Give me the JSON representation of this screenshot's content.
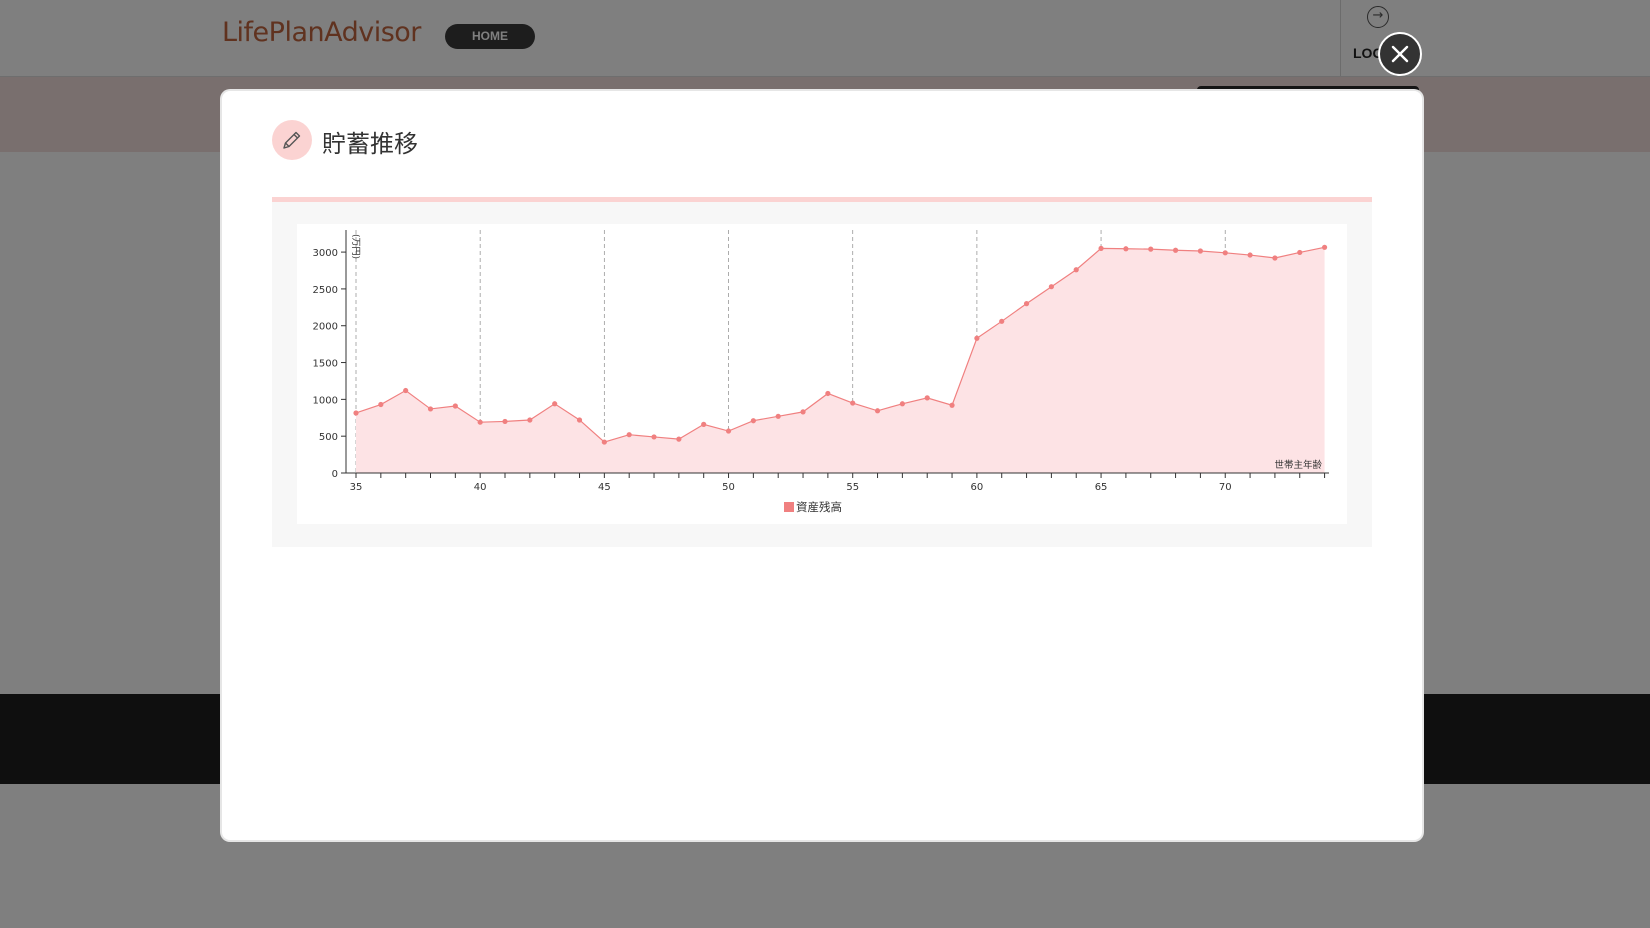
{
  "header": {
    "logo_text": "LifePlanAdvisor",
    "home_label": "HOME",
    "logout_label": "LOG"
  },
  "modal": {
    "title": "貯蓄推移",
    "close_icon": "close-icon",
    "title_icon": "pencil-icon"
  },
  "colors": {
    "series": "#f08080",
    "area": "#fde3e5",
    "accent_pink": "#fbd3d2",
    "close_bg": "#333333"
  },
  "chart_data": {
    "type": "area",
    "title": "",
    "xlabel": "世帯主年齢",
    "ylabel": "(万円)",
    "xlim": [
      35,
      74.5
    ],
    "ylim": [
      0,
      3300
    ],
    "xticks": [
      35,
      40,
      45,
      50,
      55,
      60,
      65,
      70
    ],
    "yticks": [
      0,
      500,
      1000,
      1500,
      2000,
      2500,
      3000
    ],
    "grid": "vertical-dashed",
    "legend_position": "bottom-center",
    "x": [
      35,
      36,
      37,
      38,
      39,
      40,
      41,
      42,
      43,
      44,
      45,
      46,
      47,
      48,
      49,
      50,
      51,
      52,
      53,
      54,
      55,
      56,
      57,
      58,
      59,
      60,
      61,
      62,
      63,
      64,
      65,
      66,
      67,
      68,
      69,
      70,
      71,
      72,
      73,
      74
    ],
    "series": [
      {
        "name": "資産残高",
        "values": [
          815,
          930,
          1120,
          870,
          910,
          690,
          700,
          720,
          940,
          720,
          420,
          520,
          490,
          460,
          660,
          570,
          710,
          770,
          830,
          1080,
          950,
          845,
          940,
          1020,
          920,
          1830,
          2060,
          2300,
          2530,
          2760,
          3050,
          3045,
          3040,
          3025,
          3015,
          2990,
          2960,
          2920,
          2995,
          3065
        ]
      }
    ]
  }
}
